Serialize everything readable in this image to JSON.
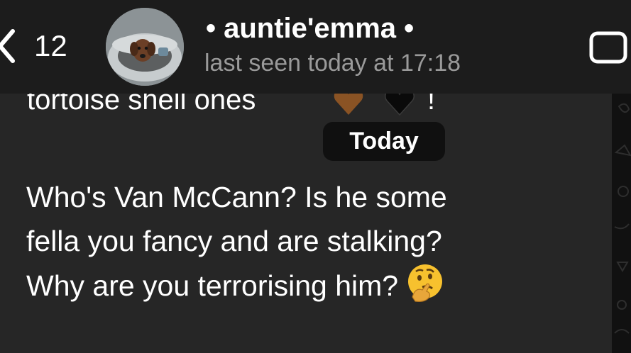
{
  "header": {
    "back_count": "12",
    "contact_name": "• auntie'emma •",
    "status": "last seen today at 17:18"
  },
  "chat": {
    "previous_message_text": "tortoise shell ones",
    "previous_message_end": "!",
    "previous_message_emojis": [
      "brown-heart-icon",
      "black-heart-icon"
    ],
    "date_separator": "Today",
    "message_lines": [
      "Who's Van McCann? Is he some",
      "fella you fancy and are stalking?",
      "Why are you terrorising him?"
    ],
    "message_emoji": "thinking-face-icon"
  },
  "colors": {
    "header_bg": "#1c1c1c",
    "bubble_bg": "#262626",
    "status_text": "#9a9a9a",
    "date_pill_bg": "#101010"
  }
}
